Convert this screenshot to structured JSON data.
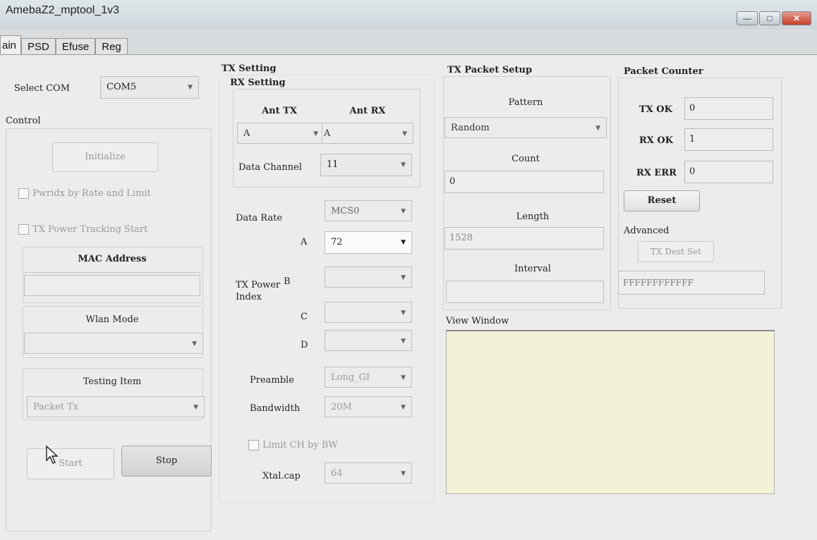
{
  "window": {
    "title": "AmebaZ2_mptool_1v3"
  },
  "tabs": [
    "ain",
    "PSD",
    "Efuse",
    "Reg"
  ],
  "main": {
    "select_com_label": "Select COM",
    "select_com_value": "COM5",
    "control_label": "Control",
    "initialize_label": "Initialize",
    "pwridx_label": "Pwridx by Rate and Limit",
    "tx_power_tracking_label": "TX Power Tracking Start",
    "mac_address_label": "MAC Address",
    "mac_address_value": "",
    "wlan_mode_label": "Wlan Mode",
    "wlan_mode_value": "",
    "testing_item_label": "Testing Item",
    "testing_item_value": "Packet Tx",
    "start_label": "Start",
    "stop_label": "Stop"
  },
  "tx_setting": {
    "title": "TX Setting",
    "rx_setting_title": "RX Setting",
    "ant_tx_label": "Ant TX",
    "ant_rx_label": "Ant RX",
    "ant_tx_value": "A",
    "ant_rx_value": "A",
    "data_channel_label": "Data Channel",
    "data_channel_value": "11",
    "data_rate_label": "Data Rate",
    "data_rate_value": "MCS0",
    "tx_power_index_label": "TX Power\nIndex",
    "power_a_label": "A",
    "power_a_value": "72",
    "power_b_label": "B",
    "power_c_label": "C",
    "power_d_label": "D",
    "preamble_label": "Preamble",
    "preamble_value": "Long_GI",
    "bandwidth_label": "Bandwidth",
    "bandwidth_value": "20M",
    "limit_ch_label": "Limit CH by BW",
    "xtalcap_label": "Xtal.cap",
    "xtalcap_value": "64"
  },
  "tx_packet": {
    "title": "TX Packet Setup",
    "pattern_label": "Pattern",
    "pattern_value": "Random",
    "count_label": "Count",
    "count_value": "0",
    "length_label": "Length",
    "length_value": "1528",
    "interval_label": "Interval",
    "interval_value": "",
    "view_window_label": "View Window"
  },
  "packet_counter": {
    "title": "Packet Counter",
    "tx_ok_label": "TX OK",
    "tx_ok_value": "0",
    "rx_ok_label": "RX OK",
    "rx_ok_value": "1",
    "rx_err_label": "RX ERR",
    "rx_err_value": "0",
    "reset_label": "Reset",
    "advanced_label": "Advanced",
    "tx_dest_set_label": "TX Dest Set",
    "tx_dest_value": "FFFFFFFFFFFF"
  },
  "colors": {
    "view_window_bg": "#f3f1d6",
    "close_button": "#c6402b"
  }
}
